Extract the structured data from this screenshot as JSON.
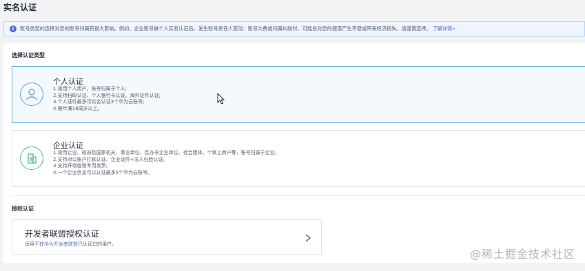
{
  "page": {
    "title": "实名认证"
  },
  "notice": {
    "text": "账号类型的选择对您的账号归属有很大影响。例如，企业账号做个人实名认证后，发生账号责任人变动、账号欠费或归属纠纷时，可能会对您的使用产生不便或带来经济损失。请谨慎选择。",
    "link": "了解详情»"
  },
  "type_section": {
    "label": "选择认证类型",
    "personal": {
      "title": "个人认证",
      "lines": [
        "1.适用个人用户，账号归属于个人;",
        "2.支持扫码认证、个人银行卡认证、海外证件认证;",
        "3.个人证件最多可实名认证3个华为云账号;",
        "4.需年满18周岁以上。"
      ]
    },
    "enterprise": {
      "title": "企业认证",
      "lines": [
        "1.适用企业、政府及国家机关、事业单位、民办非企业单位、社会团体、个体工商户等，账号归属于企业;",
        "2.支持对公账户打款认证、企业证件+法人扫脸认证;",
        "3.支持开增值税专用发票;",
        "4.一个企业信息可以认证最多5个华为云账号。"
      ]
    }
  },
  "auth_section": {
    "label": "授权认证",
    "card": {
      "title": "开发者联盟授权认证",
      "desc_prefix": "适用于在",
      "desc_highlight": "华为开发者联盟",
      "desc_suffix": "已认证过的用户。"
    }
  },
  "watermark": "@稀土掘金技术社区",
  "colors": {
    "accent": "#526ecc",
    "selected_border": "#5cadd6",
    "enterprise_icon": "#4dbb90"
  },
  "icons": {
    "notice": "info-icon",
    "personal": "person-icon",
    "enterprise": "building-icon",
    "auth_arrow": "chevron-right-icon"
  }
}
